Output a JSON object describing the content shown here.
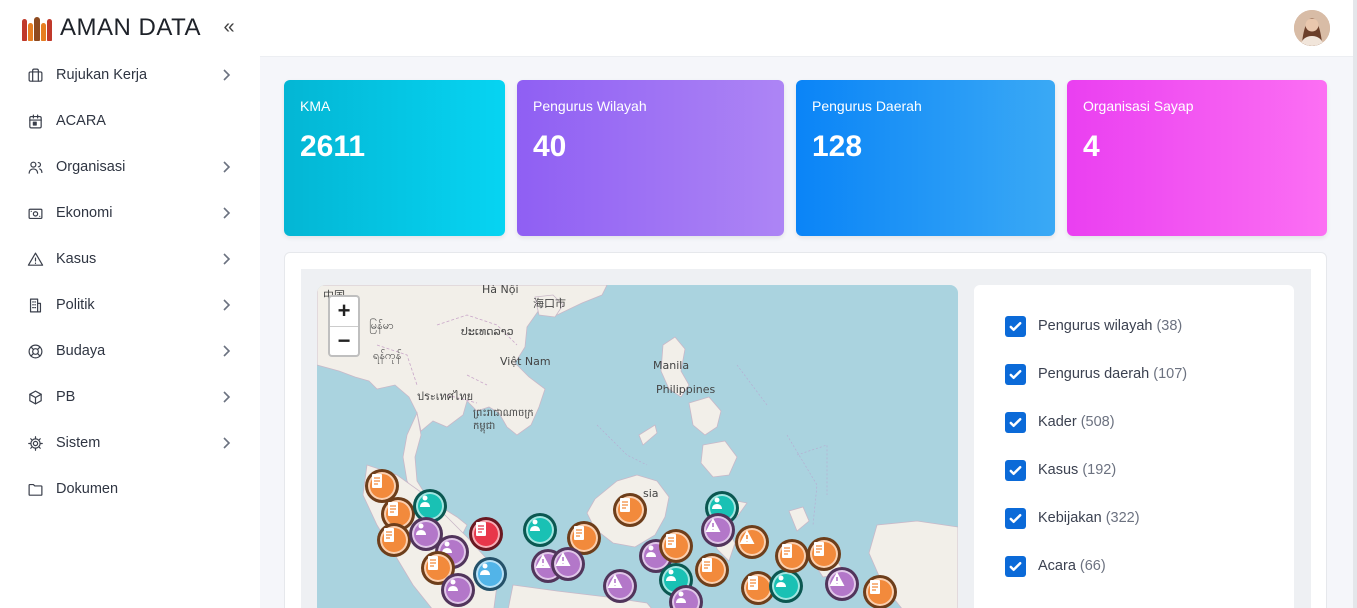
{
  "app": {
    "title": "AMAN DATA"
  },
  "sidebar": {
    "items": [
      {
        "label": "Rujukan Kerja",
        "icon": "briefcase-icon",
        "has_children": true
      },
      {
        "label": "ACARA",
        "icon": "calendar-icon",
        "has_children": false
      },
      {
        "label": "Organisasi",
        "icon": "users-icon",
        "has_children": true
      },
      {
        "label": "Ekonomi",
        "icon": "money-icon",
        "has_children": true
      },
      {
        "label": "Kasus",
        "icon": "warning-icon",
        "has_children": true
      },
      {
        "label": "Politik",
        "icon": "building-icon",
        "has_children": true
      },
      {
        "label": "Budaya",
        "icon": "lifebuoy-icon",
        "has_children": true
      },
      {
        "label": "PB",
        "icon": "box-icon",
        "has_children": true
      },
      {
        "label": "Sistem",
        "icon": "gear-icon",
        "has_children": true
      },
      {
        "label": "Dokumen",
        "icon": "folder-icon",
        "has_children": false
      }
    ]
  },
  "stats": {
    "kma": {
      "label": "KMA",
      "value": "2611",
      "color": "#04b6d4"
    },
    "wilayah": {
      "label": "Pengurus Wilayah",
      "value": "40",
      "color": "#8f5ff3"
    },
    "daerah": {
      "label": "Pengurus Daerah",
      "value": "128",
      "color": "#0a84f7"
    },
    "sayap": {
      "label": "Organisasi Sayap",
      "value": "4",
      "color": "#ea3ff1"
    }
  },
  "map": {
    "zoom_in": "+",
    "zoom_out": "−",
    "labels": {
      "china": "中国",
      "hanoi": "Hà Nội",
      "haikou": "海口市",
      "myanmar": "မြန်မာ",
      "laos": "ປະເທດລາວ",
      "vietnam": "Việt Nam",
      "yangon": "ရန်ကုန်",
      "thailand": "ประเทศไทย",
      "cambodia": "ព្រះរាជាណាចក្រកម្ពុជា",
      "manila": "Manila",
      "philippines": "Philippines",
      "malaysia": "sia"
    }
  },
  "legend": {
    "items": [
      {
        "label": "Pengurus wilayah",
        "count": "(38)",
        "checked": true
      },
      {
        "label": "Pengurus daerah",
        "count": "(107)",
        "checked": true
      },
      {
        "label": "Kader",
        "count": "(508)",
        "checked": true
      },
      {
        "label": "Kasus",
        "count": "(192)",
        "checked": true
      },
      {
        "label": "Kebijakan",
        "count": "(322)",
        "checked": true
      },
      {
        "label": "Acara",
        "count": "(66)",
        "checked": true
      }
    ]
  },
  "marker_colors": {
    "orange": "#f28a3c",
    "purple": "#b377c9",
    "teal": "#19c1b4",
    "red": "#e8364a",
    "blue": "#52b4e8"
  }
}
